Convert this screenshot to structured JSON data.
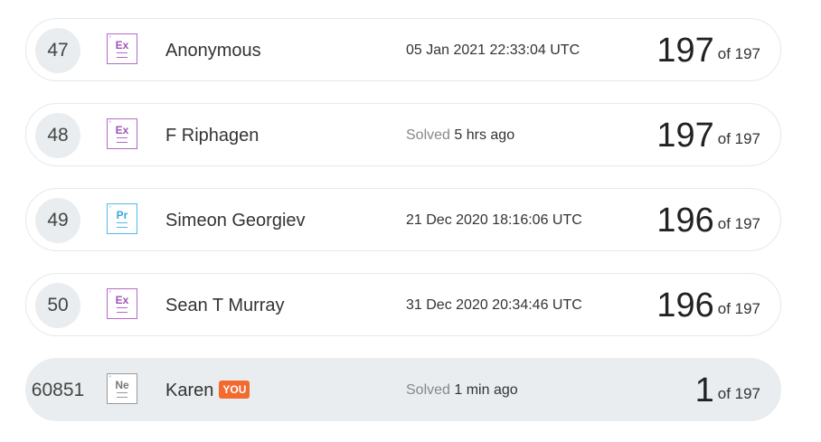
{
  "leaderboard": {
    "rows": [
      {
        "rank": "47",
        "badge": "Ex",
        "name": "Anonymous",
        "time_prefix": "",
        "time": "05 Jan 2021 22:33:04 UTC",
        "score": "197",
        "of_text": "of 197"
      },
      {
        "rank": "48",
        "badge": "Ex",
        "name": "F Riphagen",
        "time_prefix": "Solved",
        "time": "5 hrs ago",
        "score": "197",
        "of_text": "of 197"
      },
      {
        "rank": "49",
        "badge": "Pr",
        "name": "Simeon Georgiev",
        "time_prefix": "",
        "time": "21 Dec 2020 18:16:06 UTC",
        "score": "196",
        "of_text": "of 197"
      },
      {
        "rank": "50",
        "badge": "Ex",
        "name": "Sean T Murray",
        "time_prefix": "",
        "time": "31 Dec 2020 20:34:46 UTC",
        "score": "196",
        "of_text": "of 197"
      },
      {
        "rank": "60851",
        "badge": "Ne",
        "name": "Karen",
        "you_label": "YOU",
        "time_prefix": "Solved",
        "time": "1 min ago",
        "score": "1",
        "of_text": "of 197"
      }
    ]
  },
  "colors": {
    "badge_ex": "#b36ac8",
    "badge_pr": "#55b8e8",
    "badge_ne": "#9a9a9a",
    "you_badge": "#f26a2e",
    "highlight_row": "#e9edef"
  }
}
